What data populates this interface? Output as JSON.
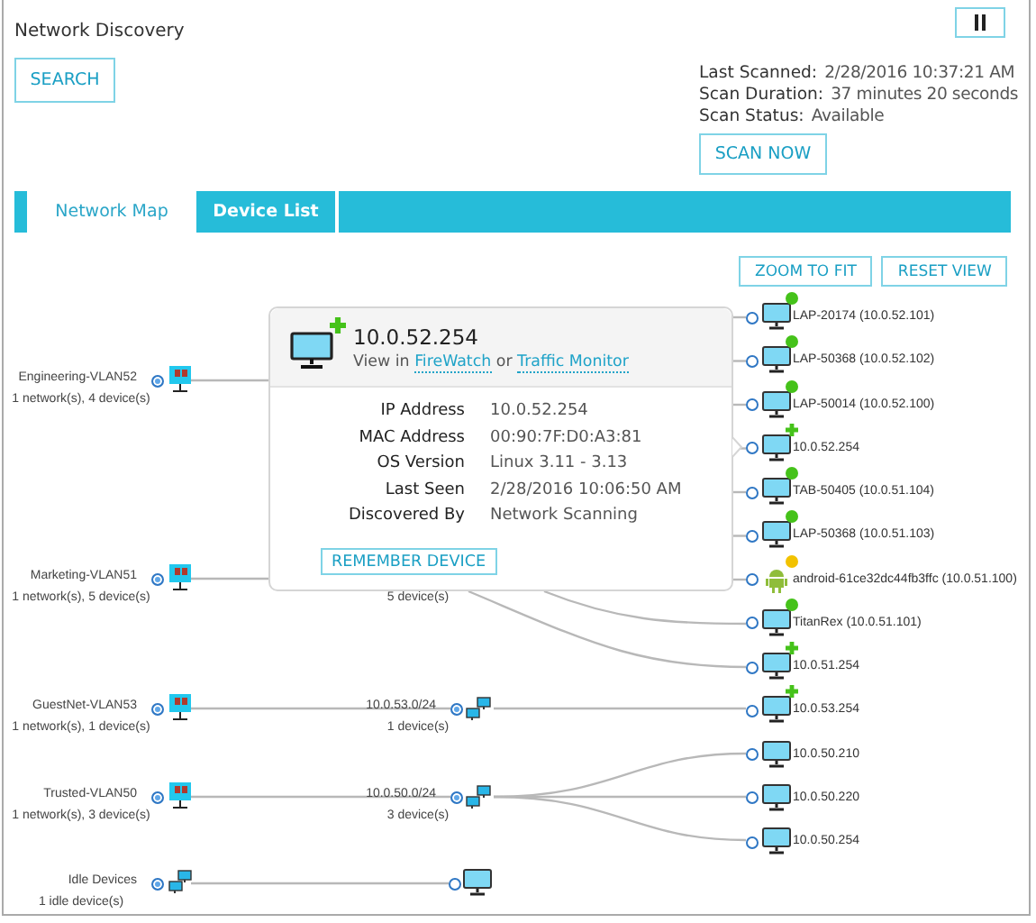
{
  "window": {
    "title": "Network Discovery"
  },
  "search_button": "SEARCH",
  "scan_info": [
    {
      "label": "Last Scanned:",
      "value": "2/28/2016 10:37:21 AM"
    },
    {
      "label": "Scan Duration:",
      "value": "37 minutes 20 seconds"
    },
    {
      "label": "Scan Status:",
      "value": "Available"
    }
  ],
  "scan_button": "SCAN NOW",
  "tabs": [
    {
      "label": "Network Map",
      "selected": true
    },
    {
      "label": "Device List",
      "selected": false
    }
  ],
  "map": {
    "buttons": [
      "ZOOM TO FIT",
      "RESET VIEW"
    ],
    "vlans": [
      {
        "name": "Engineering-VLAN52",
        "summary": "1 network(s), 4 device(s)"
      },
      {
        "name": "Marketing-VLAN51",
        "summary": "1 network(s), 5 device(s)"
      },
      {
        "name": "GuestNet-VLAN53",
        "summary": "1 network(s), 1 device(s)"
      },
      {
        "name": "Trusted-VLAN50",
        "summary": "1 network(s), 3 device(s)"
      },
      {
        "name": "Idle Devices",
        "summary": "1 idle device(s)",
        "kind": "idle"
      }
    ],
    "subnets": [
      {
        "kind": "subnet",
        "summary": "5 device(s)"
      },
      {
        "kind": "subnet",
        "label": "10.0.53.0/24",
        "summary": "1 device(s)"
      },
      {
        "kind": "subnet",
        "label": "10.0.50.0/24",
        "summary": "3 device(s)"
      },
      {
        "kind": "device"
      }
    ],
    "devices": [
      {
        "name": "LAP-20174 (10.0.52.101)",
        "kind": "monitor",
        "color": "#45c21a",
        "new": false
      },
      {
        "name": "LAP-50368 (10.0.52.102)",
        "kind": "monitor",
        "color": "#45c21a",
        "new": false
      },
      {
        "name": "LAP-50014 (10.0.52.100)",
        "kind": "monitor",
        "color": "#45c21a",
        "new": false
      },
      {
        "name": "10.0.52.254",
        "kind": "monitor",
        "new": true
      },
      {
        "name": "TAB-50405 (10.0.51.104)",
        "kind": "monitor",
        "color": "#45c21a",
        "new": false
      },
      {
        "name": "LAP-50368 (10.0.51.103)",
        "kind": "monitor",
        "color": "#45c21a",
        "new": false
      },
      {
        "name": "android-61ce32dc44fb3ffc (10.0.51.100)",
        "kind": "android",
        "color": "#f2c200",
        "new": false
      },
      {
        "name": "TitanRex (10.0.51.101)",
        "kind": "monitor",
        "color": "#45c21a",
        "new": false
      },
      {
        "name": "10.0.51.254",
        "kind": "monitor",
        "new": true
      },
      {
        "name": "10.0.53.254",
        "kind": "monitor",
        "new": true
      },
      {
        "name": "10.0.50.210",
        "kind": "monitor",
        "new": false
      },
      {
        "name": "10.0.50.220",
        "kind": "monitor",
        "new": false
      },
      {
        "name": "10.0.50.254",
        "kind": "monitor",
        "new": false
      }
    ]
  },
  "popup": {
    "title": "10.0.52.254",
    "new": true,
    "view_prefix": "View in",
    "links": [
      "FireWatch",
      "Traffic Monitor"
    ],
    "joiner": "or",
    "details": [
      {
        "label": "IP Address",
        "value": "10.0.52.254"
      },
      {
        "label": "MAC Address",
        "value": "00:90:7F:D0:A3:81"
      },
      {
        "label": "OS Version",
        "value": "Linux 3.11 - 3.13"
      },
      {
        "label": "Last Seen",
        "value": "2/28/2016 10:06:50 AM"
      },
      {
        "label": "Discovered By",
        "value": "Network Scanning"
      }
    ],
    "button": "REMEMBER DEVICE"
  }
}
